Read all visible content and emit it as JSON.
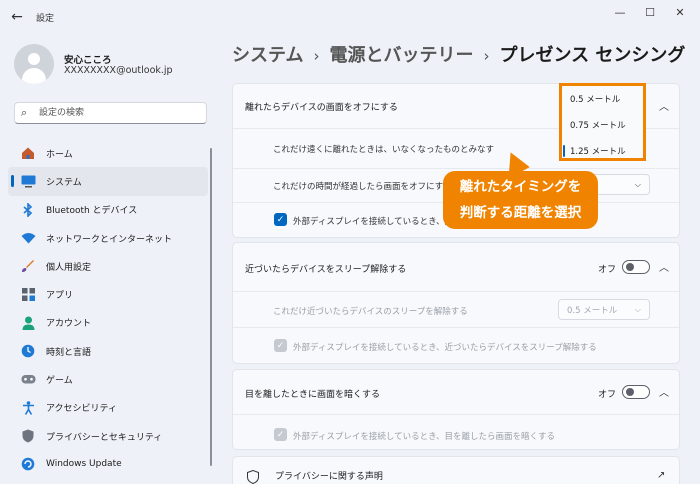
{
  "window": {
    "title": "設定",
    "minimize": "—",
    "maximize": "☐",
    "close": "✕"
  },
  "user": {
    "name": "安心こころ",
    "email": "XXXXXXXX@outlook.jp"
  },
  "search": {
    "placeholder": "設定の検索"
  },
  "nav": {
    "items": [
      {
        "label": "ホーム",
        "icon": "home-icon"
      },
      {
        "label": "システム",
        "icon": "system-icon",
        "active": true
      },
      {
        "label": "Bluetooth とデバイス",
        "icon": "bluetooth-icon"
      },
      {
        "label": "ネットワークとインターネット",
        "icon": "network-icon"
      },
      {
        "label": "個人用設定",
        "icon": "brush-icon"
      },
      {
        "label": "アプリ",
        "icon": "apps-icon"
      },
      {
        "label": "アカウント",
        "icon": "account-icon"
      },
      {
        "label": "時刻と言語",
        "icon": "time-language-icon"
      },
      {
        "label": "ゲーム",
        "icon": "game-icon"
      },
      {
        "label": "アクセシビリティ",
        "icon": "accessibility-icon"
      },
      {
        "label": "プライバシーとセキュリティ",
        "icon": "shield-icon"
      },
      {
        "label": "Windows Update",
        "icon": "update-icon"
      }
    ]
  },
  "breadcrumb": {
    "part1": "システム",
    "part2": "電源とバッテリー",
    "part3": "プレゼンス センシング",
    "sep": "›"
  },
  "section1": {
    "title": "離れたらデバイスの画面をオフにする",
    "distance_label": "これだけ遠くに離れたときは、いなくなったものとみなす",
    "time_label": "これだけの時間が経過したら画面をオフにす",
    "external_label": "外部ディスプレイを接続しているとき、離",
    "external_checked": true
  },
  "dropdown": {
    "options": [
      "0.5 メートル",
      "0.75 メートル",
      "1.25 メートル"
    ],
    "selected": "1.25 メートル"
  },
  "callout": {
    "line1": "離れたタイミングを",
    "line2": "判断する距離を選択"
  },
  "section2": {
    "title": "近づいたらデバイスをスリープ解除する",
    "toggle_label": "オフ",
    "distance_label": "これだけ近づいたらデバイスのスリープを解除する",
    "distance_value": "0.5 メートル",
    "external_label": "外部ディスプレイを接続しているとき、近づいたらデバイスをスリープ解除する"
  },
  "section3": {
    "title": "目を離したときに画面を暗くする",
    "toggle_label": "オフ",
    "external_label": "外部ディスプレイを接続しているとき、目を離したら画面を暗くする"
  },
  "section4": {
    "title": "プライバシーに関する声明"
  },
  "colors": {
    "accent": "#0067c0",
    "highlight": "#f08300"
  }
}
